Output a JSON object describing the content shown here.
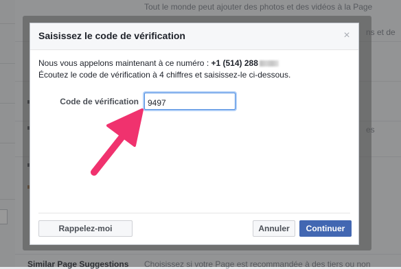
{
  "background": {
    "row1_text": "Tout le monde peut ajouter des photos et des vidéos à la Page",
    "right_fragment_1": "ns et de",
    "right_fragment_2": "es",
    "footer_label": "Similar Page Suggestions",
    "footer_text": "Choisissez si votre Page est recommandée à des tiers ou non"
  },
  "dialog": {
    "title": "Saisissez le code de vérification",
    "message_prefix": "Nous vous appelons maintenant à ce numéro : ",
    "phone_visible": "+1 (514) 288",
    "message_line2": "Écoutez le code de vérification à 4 chiffres et saisissez-le ci-dessous.",
    "code_label": "Code de vérification",
    "code_value": "9497",
    "recall_label": "Rappelez-moi",
    "cancel_label": "Annuler",
    "continue_label": "Continuer",
    "close_glyph": "×"
  },
  "icons": {
    "close": "close-icon"
  },
  "colors": {
    "primary_button": "#4267b2",
    "focus_border": "#4c8cdf",
    "annotation_arrow": "#f0326e"
  }
}
